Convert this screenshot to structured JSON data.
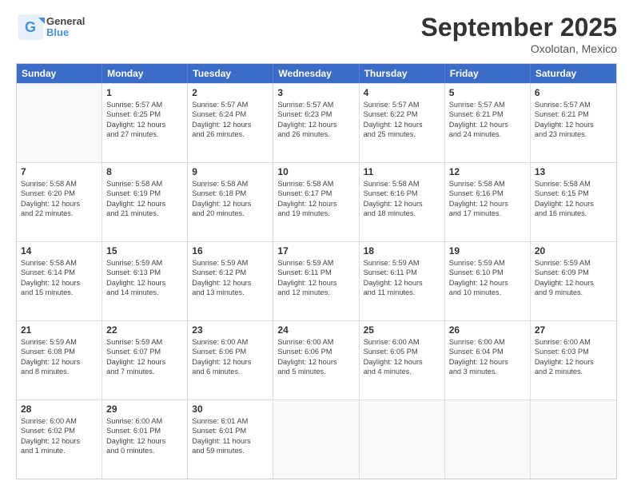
{
  "logo": {
    "general": "General",
    "blue": "Blue"
  },
  "title": "September 2025",
  "subtitle": "Oxolotan, Mexico",
  "days_of_week": [
    "Sunday",
    "Monday",
    "Tuesday",
    "Wednesday",
    "Thursday",
    "Friday",
    "Saturday"
  ],
  "weeks": [
    [
      {
        "day": "",
        "info": ""
      },
      {
        "day": "1",
        "info": "Sunrise: 5:57 AM\nSunset: 6:25 PM\nDaylight: 12 hours\nand 27 minutes."
      },
      {
        "day": "2",
        "info": "Sunrise: 5:57 AM\nSunset: 6:24 PM\nDaylight: 12 hours\nand 26 minutes."
      },
      {
        "day": "3",
        "info": "Sunrise: 5:57 AM\nSunset: 6:23 PM\nDaylight: 12 hours\nand 26 minutes."
      },
      {
        "day": "4",
        "info": "Sunrise: 5:57 AM\nSunset: 6:22 PM\nDaylight: 12 hours\nand 25 minutes."
      },
      {
        "day": "5",
        "info": "Sunrise: 5:57 AM\nSunset: 6:21 PM\nDaylight: 12 hours\nand 24 minutes."
      },
      {
        "day": "6",
        "info": "Sunrise: 5:57 AM\nSunset: 6:21 PM\nDaylight: 12 hours\nand 23 minutes."
      }
    ],
    [
      {
        "day": "7",
        "info": "Sunrise: 5:58 AM\nSunset: 6:20 PM\nDaylight: 12 hours\nand 22 minutes."
      },
      {
        "day": "8",
        "info": "Sunrise: 5:58 AM\nSunset: 6:19 PM\nDaylight: 12 hours\nand 21 minutes."
      },
      {
        "day": "9",
        "info": "Sunrise: 5:58 AM\nSunset: 6:18 PM\nDaylight: 12 hours\nand 20 minutes."
      },
      {
        "day": "10",
        "info": "Sunrise: 5:58 AM\nSunset: 6:17 PM\nDaylight: 12 hours\nand 19 minutes."
      },
      {
        "day": "11",
        "info": "Sunrise: 5:58 AM\nSunset: 6:16 PM\nDaylight: 12 hours\nand 18 minutes."
      },
      {
        "day": "12",
        "info": "Sunrise: 5:58 AM\nSunset: 6:16 PM\nDaylight: 12 hours\nand 17 minutes."
      },
      {
        "day": "13",
        "info": "Sunrise: 5:58 AM\nSunset: 6:15 PM\nDaylight: 12 hours\nand 16 minutes."
      }
    ],
    [
      {
        "day": "14",
        "info": "Sunrise: 5:58 AM\nSunset: 6:14 PM\nDaylight: 12 hours\nand 15 minutes."
      },
      {
        "day": "15",
        "info": "Sunrise: 5:59 AM\nSunset: 6:13 PM\nDaylight: 12 hours\nand 14 minutes."
      },
      {
        "day": "16",
        "info": "Sunrise: 5:59 AM\nSunset: 6:12 PM\nDaylight: 12 hours\nand 13 minutes."
      },
      {
        "day": "17",
        "info": "Sunrise: 5:59 AM\nSunset: 6:11 PM\nDaylight: 12 hours\nand 12 minutes."
      },
      {
        "day": "18",
        "info": "Sunrise: 5:59 AM\nSunset: 6:11 PM\nDaylight: 12 hours\nand 11 minutes."
      },
      {
        "day": "19",
        "info": "Sunrise: 5:59 AM\nSunset: 6:10 PM\nDaylight: 12 hours\nand 10 minutes."
      },
      {
        "day": "20",
        "info": "Sunrise: 5:59 AM\nSunset: 6:09 PM\nDaylight: 12 hours\nand 9 minutes."
      }
    ],
    [
      {
        "day": "21",
        "info": "Sunrise: 5:59 AM\nSunset: 6:08 PM\nDaylight: 12 hours\nand 8 minutes."
      },
      {
        "day": "22",
        "info": "Sunrise: 5:59 AM\nSunset: 6:07 PM\nDaylight: 12 hours\nand 7 minutes."
      },
      {
        "day": "23",
        "info": "Sunrise: 6:00 AM\nSunset: 6:06 PM\nDaylight: 12 hours\nand 6 minutes."
      },
      {
        "day": "24",
        "info": "Sunrise: 6:00 AM\nSunset: 6:06 PM\nDaylight: 12 hours\nand 5 minutes."
      },
      {
        "day": "25",
        "info": "Sunrise: 6:00 AM\nSunset: 6:05 PM\nDaylight: 12 hours\nand 4 minutes."
      },
      {
        "day": "26",
        "info": "Sunrise: 6:00 AM\nSunset: 6:04 PM\nDaylight: 12 hours\nand 3 minutes."
      },
      {
        "day": "27",
        "info": "Sunrise: 6:00 AM\nSunset: 6:03 PM\nDaylight: 12 hours\nand 2 minutes."
      }
    ],
    [
      {
        "day": "28",
        "info": "Sunrise: 6:00 AM\nSunset: 6:02 PM\nDaylight: 12 hours\nand 1 minute."
      },
      {
        "day": "29",
        "info": "Sunrise: 6:00 AM\nSunset: 6:01 PM\nDaylight: 12 hours\nand 0 minutes."
      },
      {
        "day": "30",
        "info": "Sunrise: 6:01 AM\nSunset: 6:01 PM\nDaylight: 11 hours\nand 59 minutes."
      },
      {
        "day": "",
        "info": ""
      },
      {
        "day": "",
        "info": ""
      },
      {
        "day": "",
        "info": ""
      },
      {
        "day": "",
        "info": ""
      }
    ]
  ]
}
